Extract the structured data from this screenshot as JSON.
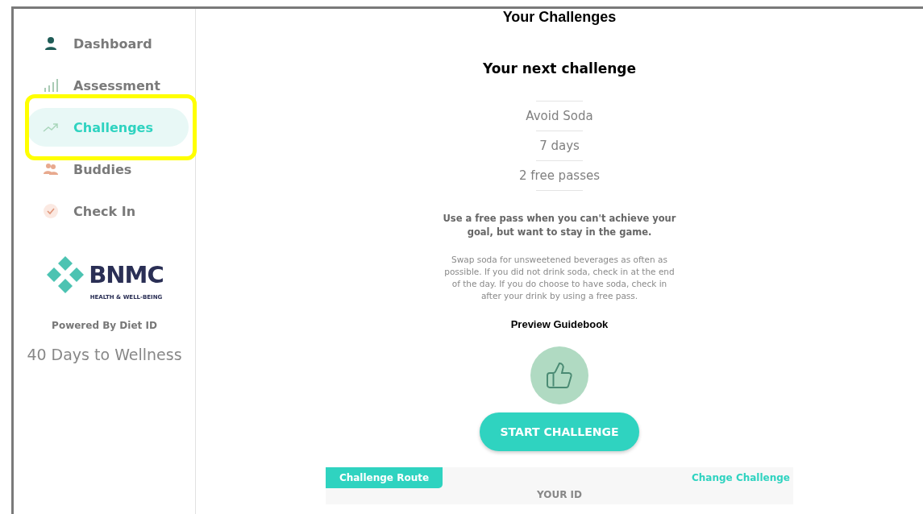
{
  "sidebar": {
    "items": [
      {
        "label": "Dashboard",
        "kind": "person",
        "selected": false,
        "highlighted": false
      },
      {
        "label": "Assessment",
        "kind": "bars",
        "selected": false,
        "highlighted": false
      },
      {
        "label": "Challenges",
        "kind": "trend",
        "selected": true,
        "highlighted": true
      },
      {
        "label": "Buddies",
        "kind": "people",
        "selected": false,
        "highlighted": false
      },
      {
        "label": "Check In",
        "kind": "check",
        "selected": false,
        "highlighted": false
      }
    ],
    "logo": {
      "name": "BNMC",
      "tagline": "HEALTH & WELL-BEING"
    },
    "powered_by": "Powered By Diet ID",
    "program": "40 Days to Wellness"
  },
  "main": {
    "title": "Your Challenges",
    "subtitle": "Your next challenge",
    "details": [
      "Avoid Soda",
      "7 days",
      "2 free passes"
    ],
    "note": "Use a free pass when you can't achieve your goal, but want to stay in the game.",
    "description": "Swap soda for unsweetened beverages as often as possible. If you did not drink soda, check in at the end of the day. If you do choose to have soda, check in after your drink by using a free pass.",
    "guidebook_link": "Preview Guidebook",
    "start_button": "START CHALLENGE",
    "route": {
      "tab": "Challenge Route",
      "change_link": "Change Challenge",
      "heading": "YOUR ID"
    }
  }
}
